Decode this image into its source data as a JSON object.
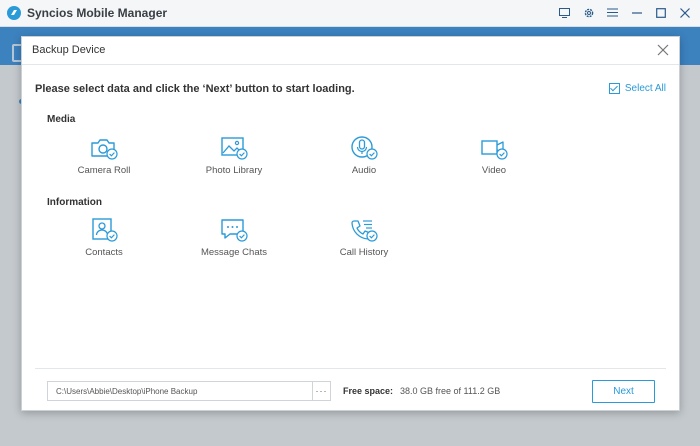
{
  "app": {
    "title": "Syncios Mobile Manager",
    "accent": "#2a9ad8"
  },
  "window_controls": [
    "screen-icon",
    "gear-icon",
    "menu-icon",
    "minimize-icon",
    "maximize-icon",
    "close-icon"
  ],
  "dialog": {
    "title": "Backup Device",
    "instruction": "Please select data and click the ‘Next’ button to start loading.",
    "select_all": {
      "label": "Select All",
      "checked": true
    },
    "sections": [
      {
        "title": "Media",
        "items": [
          {
            "label": "Camera Roll",
            "icon": "camera-icon",
            "checked": true
          },
          {
            "label": "Photo Library",
            "icon": "photo-icon",
            "checked": true
          },
          {
            "label": "Audio",
            "icon": "audio-icon",
            "checked": true
          },
          {
            "label": "Video",
            "icon": "video-icon",
            "checked": true
          }
        ]
      },
      {
        "title": "Information",
        "items": [
          {
            "label": "Contacts",
            "icon": "contacts-icon",
            "checked": true
          },
          {
            "label": "Message Chats",
            "icon": "message-icon",
            "checked": true
          },
          {
            "label": "Call History",
            "icon": "call-history-icon",
            "checked": true
          }
        ]
      }
    ],
    "footer": {
      "path_value": "C:\\Users\\Abbie\\Desktop\\iPhone Backup",
      "browse_label": "···",
      "free_space_label": "Free space:",
      "free_space_value": "38.0 GB free of 111.2 GB",
      "next_label": "Next"
    }
  }
}
